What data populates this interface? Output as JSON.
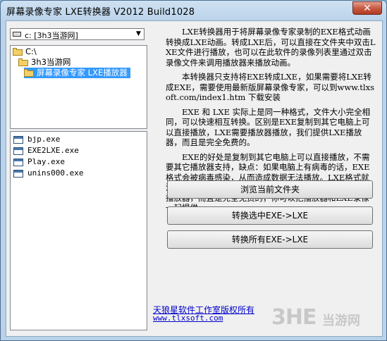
{
  "window": {
    "title": "屏幕录像专家 LXE转换器 V2012 Build1028",
    "close_glyph": "✕"
  },
  "drive_select": {
    "value": "c: [3h3当游网]"
  },
  "dir_list": {
    "items": [
      {
        "label": "C:\\",
        "selected": false
      },
      {
        "label": "3h3当游网",
        "selected": false
      },
      {
        "label": "屏幕录像专家 LXE播放器",
        "selected": true
      }
    ]
  },
  "file_list": {
    "items": [
      "bjp.exe",
      "EXE2LXE.exe",
      "Play.exe",
      "unins000.exe"
    ]
  },
  "description": {
    "p1": "LXE转换器用于将屏幕录像专家录制的EXE格式动画转换成LXE动画。转成LXE后，可以直接在文件夹中双击LXE文件进行播放，也可以在此软件的录像列表里通过双击录像文件来调用播放器来播放动画。",
    "p2": "本转换器只支持将EXE转成LXE，如果需要将LXE转成EXE，需要使用最新版屏幕录像专家，可以到www.tlxsoft.com/index1.htm 下载安装",
    "p3": "EXE 和 LXE 实际上是同一种格式，文件大小完全相同，可以快速相互转换。区别是EXE复制到其它电脑上可以直接播放，LXE需要播放器播放，我们提供LXE播放器，而且是完全免费的。",
    "p4": "EXE的好处是复制到其它电脑上可以直接播放，不需要其它播放器支持，缺点：如果电脑上有病毒的话，EXE格式会被病毒感染，从而造成数据无法播放。LXE格式就没有EXE的缺点，只是需要播放器来播放，我们提供LXE播放器，而且是完全免费的，你可以把播放器和LXE录像一起提供。"
  },
  "buttons": {
    "browse": "浏览当前文件夹",
    "convert_selected": "转换选中EXE->LXE",
    "convert_all": "转换所有EXE->LXE"
  },
  "footer": {
    "copyright": "天狼星软件工作室版权所有",
    "website": "www.tlxsoft.com"
  },
  "watermark": {
    "logo": "3HE",
    "text": "当游网"
  }
}
